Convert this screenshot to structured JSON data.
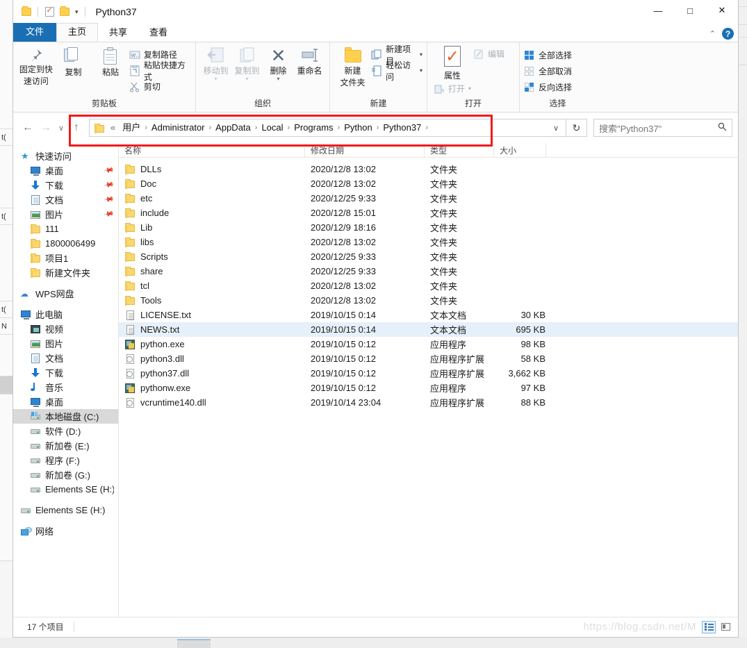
{
  "window": {
    "title": "Python37",
    "controls": {
      "minimize": "—",
      "maximize": "□",
      "close": "✕"
    },
    "quick_access": {
      "dropdown_caret": "▾"
    }
  },
  "tabs": [
    {
      "id": "file",
      "label": "文件"
    },
    {
      "id": "home",
      "label": "主页"
    },
    {
      "id": "share",
      "label": "共享"
    },
    {
      "id": "view",
      "label": "查看"
    }
  ],
  "ribbon": {
    "collapse_caret": "⌃",
    "help_label": "?",
    "groups": [
      {
        "name": "clipboard",
        "label": "剪贴板",
        "big": [
          {
            "id": "pin-to-quick-access",
            "label": "固定到快\n速访问",
            "line1": "固定到快",
            "line2": "速访问"
          },
          {
            "id": "copy",
            "label": "复制"
          },
          {
            "id": "paste",
            "label": "粘贴"
          }
        ],
        "small": [
          {
            "id": "copy-path",
            "label": "复制路径"
          },
          {
            "id": "paste-shortcut",
            "label": "粘贴快捷方式"
          },
          {
            "id": "cut",
            "label": "剪切"
          }
        ]
      },
      {
        "name": "organize",
        "label": "组织",
        "big": [
          {
            "id": "move-to",
            "label": "移动到",
            "dimmed": true,
            "caret": "▾"
          },
          {
            "id": "copy-to",
            "label": "复制到",
            "dimmed": true,
            "caret": "▾"
          },
          {
            "id": "delete",
            "label": "删除",
            "dimmed": false,
            "caret": "▾"
          },
          {
            "id": "rename",
            "label": "重命名",
            "dimmed": false
          }
        ]
      },
      {
        "name": "new",
        "label": "新建",
        "big": [
          {
            "id": "new-folder",
            "line1": "新建",
            "line2": "文件夹"
          }
        ],
        "small": [
          {
            "id": "new-item",
            "label": "新建项目",
            "caret": "▾"
          },
          {
            "id": "easy-access",
            "label": "轻松访问",
            "caret": "▾"
          }
        ]
      },
      {
        "name": "open",
        "label": "打开",
        "big": [
          {
            "id": "properties",
            "label": "属性"
          }
        ],
        "small": [
          {
            "id": "edit",
            "label": "编辑",
            "dimmed": true
          },
          {
            "id": "open",
            "label": "打开",
            "dimmed": true,
            "caret": "▾"
          }
        ]
      },
      {
        "name": "select",
        "label": "选择",
        "small": [
          {
            "id": "select-all",
            "label": "全部选择"
          },
          {
            "id": "select-none",
            "label": "全部取消"
          },
          {
            "id": "invert-selection",
            "label": "反向选择"
          }
        ]
      }
    ]
  },
  "addressbar": {
    "back": "←",
    "forward": "→",
    "recent_caret": "∨",
    "up": "↑",
    "crumbs": [
      {
        "label": "«"
      },
      {
        "label": "用户"
      },
      {
        "label": "Administrator"
      },
      {
        "label": "AppData"
      },
      {
        "label": "Local"
      },
      {
        "label": "Programs"
      },
      {
        "label": "Python"
      },
      {
        "label": "Python37"
      }
    ],
    "crumb_separator": "›",
    "dropdown_caret": "∨",
    "refresh": "↻",
    "search_placeholder": "搜索\"Python37\"",
    "search_value": "",
    "search_icon": "⌕"
  },
  "navpane": {
    "items": [
      {
        "id": "quick-access",
        "label": "快速访问",
        "icon": "star",
        "indent": 0,
        "pinned": false
      },
      {
        "id": "desktop",
        "label": "桌面",
        "icon": "monitor",
        "indent": 1,
        "pinned": true
      },
      {
        "id": "downloads",
        "label": "下载",
        "icon": "download",
        "indent": 1,
        "pinned": true
      },
      {
        "id": "documents",
        "label": "文档",
        "icon": "doc",
        "indent": 1,
        "pinned": true
      },
      {
        "id": "pictures",
        "label": "图片",
        "icon": "picture",
        "indent": 1,
        "pinned": true
      },
      {
        "id": "folder-111",
        "label": "111",
        "icon": "folder",
        "indent": 1,
        "pinned": false
      },
      {
        "id": "folder-1800006499",
        "label": "1800006499",
        "icon": "folder",
        "indent": 1,
        "pinned": false
      },
      {
        "id": "folder-xiangmu1",
        "label": "项目1",
        "icon": "folder",
        "indent": 1,
        "pinned": false
      },
      {
        "id": "folder-new",
        "label": "新建文件夹",
        "icon": "folder",
        "indent": 1,
        "pinned": false
      },
      {
        "id": "wps-cloud",
        "label": "WPS网盘",
        "icon": "cloud",
        "indent": 0,
        "pinned": false,
        "gap_before": true
      },
      {
        "id": "this-pc",
        "label": "此电脑",
        "icon": "monitor",
        "indent": 0,
        "pinned": false,
        "gap_before": true
      },
      {
        "id": "videos",
        "label": "视频",
        "icon": "video",
        "indent": 1,
        "pinned": false
      },
      {
        "id": "pc-pictures",
        "label": "图片",
        "icon": "picture",
        "indent": 1,
        "pinned": false
      },
      {
        "id": "pc-documents",
        "label": "文档",
        "icon": "doc",
        "indent": 1,
        "pinned": false
      },
      {
        "id": "pc-downloads",
        "label": "下载",
        "icon": "download",
        "indent": 1,
        "pinned": false
      },
      {
        "id": "music",
        "label": "音乐",
        "icon": "music",
        "indent": 1,
        "pinned": false
      },
      {
        "id": "pc-desktop",
        "label": "桌面",
        "icon": "monitor",
        "indent": 1,
        "pinned": false
      },
      {
        "id": "drive-c",
        "label": "本地磁盘 (C:)",
        "icon": "drive-c",
        "indent": 1,
        "pinned": false,
        "selected": true
      },
      {
        "id": "drive-d",
        "label": "软件 (D:)",
        "icon": "drive",
        "indent": 1,
        "pinned": false
      },
      {
        "id": "drive-e",
        "label": "新加卷 (E:)",
        "icon": "drive",
        "indent": 1,
        "pinned": false
      },
      {
        "id": "drive-f",
        "label": "程序 (F:)",
        "icon": "drive",
        "indent": 1,
        "pinned": false
      },
      {
        "id": "drive-g",
        "label": "新加卷 (G:)",
        "icon": "drive",
        "indent": 1,
        "pinned": false
      },
      {
        "id": "drive-h",
        "label": "Elements SE (H:)",
        "icon": "drive",
        "indent": 1,
        "pinned": false
      },
      {
        "id": "drive-h-root",
        "label": "Elements SE (H:)",
        "icon": "drive",
        "indent": 0,
        "pinned": false,
        "gap_before": true
      },
      {
        "id": "network",
        "label": "网络",
        "icon": "network",
        "indent": 0,
        "pinned": false,
        "gap_before": true
      }
    ]
  },
  "filelist": {
    "columns": [
      {
        "id": "name",
        "label": "名称"
      },
      {
        "id": "date",
        "label": "修改日期"
      },
      {
        "id": "type",
        "label": "类型"
      },
      {
        "id": "size",
        "label": "大小"
      }
    ],
    "rows": [
      {
        "name": "DLLs",
        "date": "2020/12/8 13:02",
        "type": "文件夹",
        "size": "",
        "icon": "folder",
        "selected": false
      },
      {
        "name": "Doc",
        "date": "2020/12/8 13:02",
        "type": "文件夹",
        "size": "",
        "icon": "folder",
        "selected": false
      },
      {
        "name": "etc",
        "date": "2020/12/25 9:33",
        "type": "文件夹",
        "size": "",
        "icon": "folder",
        "selected": false
      },
      {
        "name": "include",
        "date": "2020/12/8 15:01",
        "type": "文件夹",
        "size": "",
        "icon": "folder",
        "selected": false
      },
      {
        "name": "Lib",
        "date": "2020/12/9 18:16",
        "type": "文件夹",
        "size": "",
        "icon": "folder",
        "selected": false
      },
      {
        "name": "libs",
        "date": "2020/12/8 13:02",
        "type": "文件夹",
        "size": "",
        "icon": "folder",
        "selected": false
      },
      {
        "name": "Scripts",
        "date": "2020/12/25 9:33",
        "type": "文件夹",
        "size": "",
        "icon": "folder",
        "selected": false
      },
      {
        "name": "share",
        "date": "2020/12/25 9:33",
        "type": "文件夹",
        "size": "",
        "icon": "folder",
        "selected": false
      },
      {
        "name": "tcl",
        "date": "2020/12/8 13:02",
        "type": "文件夹",
        "size": "",
        "icon": "folder",
        "selected": false
      },
      {
        "name": "Tools",
        "date": "2020/12/8 13:02",
        "type": "文件夹",
        "size": "",
        "icon": "folder",
        "selected": false
      },
      {
        "name": "LICENSE.txt",
        "date": "2019/10/15 0:14",
        "type": "文本文档",
        "size": "30 KB",
        "icon": "text",
        "selected": false
      },
      {
        "name": "NEWS.txt",
        "date": "2019/10/15 0:14",
        "type": "文本文档",
        "size": "695 KB",
        "icon": "text",
        "selected": true
      },
      {
        "name": "python.exe",
        "date": "2019/10/15 0:12",
        "type": "应用程序",
        "size": "98 KB",
        "icon": "exe",
        "selected": false
      },
      {
        "name": "python3.dll",
        "date": "2019/10/15 0:12",
        "type": "应用程序扩展",
        "size": "58 KB",
        "icon": "dll",
        "selected": false
      },
      {
        "name": "python37.dll",
        "date": "2019/10/15 0:12",
        "type": "应用程序扩展",
        "size": "3,662 KB",
        "icon": "dll",
        "selected": false
      },
      {
        "name": "pythonw.exe",
        "date": "2019/10/15 0:12",
        "type": "应用程序",
        "size": "97 KB",
        "icon": "exe",
        "selected": false
      },
      {
        "name": "vcruntime140.dll",
        "date": "2019/10/14 23:04",
        "type": "应用程序扩展",
        "size": "88 KB",
        "icon": "dll",
        "selected": false
      }
    ]
  },
  "statusbar": {
    "item_count": "17 个项目",
    "watermark": "https://blog.csdn.net/M",
    "view_details": "details-view",
    "view_large": "large-icons-view"
  },
  "annotation": {
    "color": "#f3191b"
  },
  "colors": {
    "accent": "#1a6fb4",
    "selection": "#e5f0fa",
    "nav_selection": "#d9d9d9",
    "folder_yellow": "#fcd770",
    "annotation_red": "#f3191b"
  }
}
